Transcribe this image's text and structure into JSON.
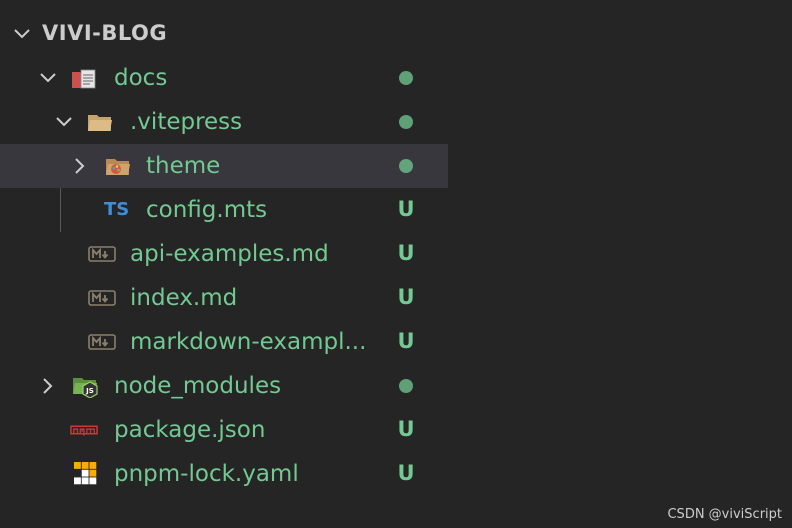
{
  "explorer": {
    "root_title": "VIVI-BLOG",
    "items": [
      {
        "label": "docs",
        "status": "dot",
        "icon": "folder-docs-icon",
        "expanded": true
      },
      {
        "label": ".vitepress",
        "status": "dot",
        "icon": "folder-icon",
        "expanded": true
      },
      {
        "label": "theme",
        "status": "dot",
        "icon": "folder-theme-icon",
        "expanded": false,
        "selected": true
      },
      {
        "label": "config.mts",
        "status": "U",
        "icon": "typescript-icon",
        "icon_text": "TS"
      },
      {
        "label": "api-examples.md",
        "status": "U",
        "icon": "markdown-icon"
      },
      {
        "label": "index.md",
        "status": "U",
        "icon": "markdown-icon"
      },
      {
        "label": "markdown-exampl...",
        "status": "U",
        "icon": "markdown-icon"
      },
      {
        "label": "node_modules",
        "status": "dot",
        "icon": "folder-node-icon",
        "expanded": false
      },
      {
        "label": "package.json",
        "status": "U",
        "icon": "npm-icon"
      },
      {
        "label": "pnpm-lock.yaml",
        "status": "U",
        "icon": "pnpm-icon"
      }
    ]
  },
  "watermark": "CSDN @viviScript",
  "colors": {
    "background": "#252526",
    "selected_row": "#37373d",
    "git_untracked": "#73c991",
    "header_text": "#cccccc",
    "ts_blue": "#3d8fd6"
  }
}
